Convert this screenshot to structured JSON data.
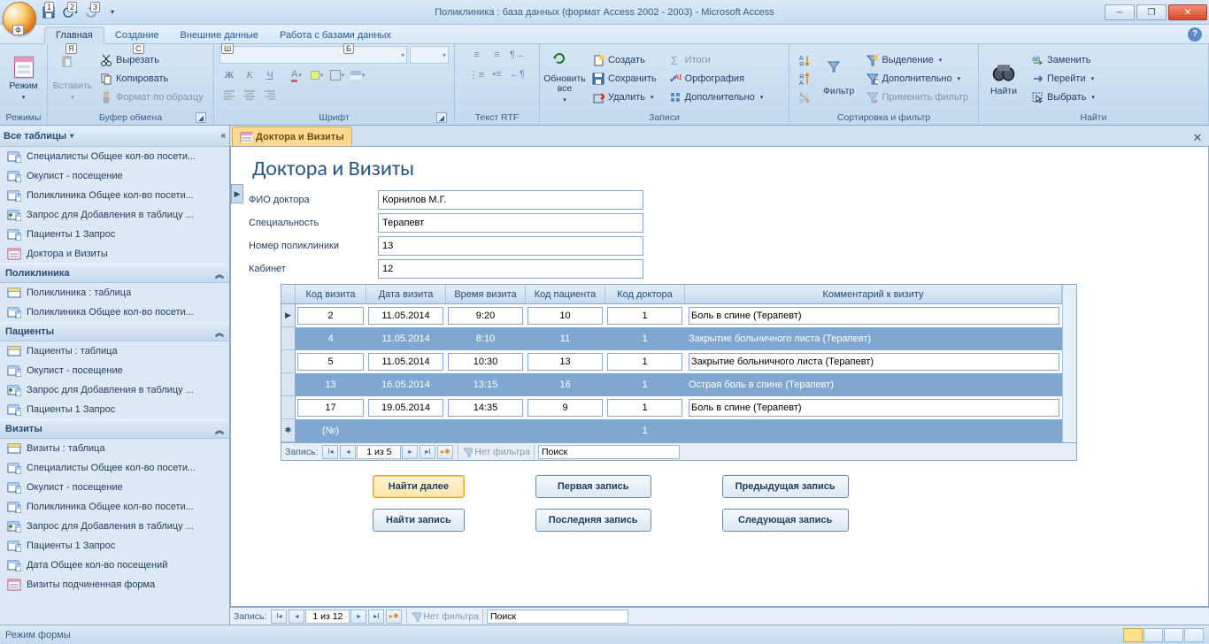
{
  "window": {
    "title": "Поликлиника : база данных (формат Access 2002 - 2003) - Microsoft Access",
    "kb_hints": [
      "1",
      "2",
      "3"
    ],
    "tabs": {
      "main": "Главная",
      "create": "Создание",
      "external": "Внешние данные",
      "dbtools": "Работа с базами данных"
    },
    "tab_kb": {
      "main": "Я",
      "create": "С",
      "external": "Ш",
      "dbtools": "Б"
    }
  },
  "ribbon": {
    "modes": {
      "big": "Режим",
      "group": "Режимы"
    },
    "clipboard": {
      "paste": "Вставить",
      "cut": "Вырезать",
      "copy": "Копировать",
      "format": "Формат по образцу",
      "group": "Буфер обмена"
    },
    "font": {
      "group": "Шрифт"
    },
    "richtext": {
      "group": "Текст RTF"
    },
    "records": {
      "refresh": "Обновить\nвсе",
      "new": "Создать",
      "save": "Сохранить",
      "delete": "Удалить",
      "totals": "Итоги",
      "spell": "Орфография",
      "more": "Дополнительно",
      "group": "Записи"
    },
    "sort": {
      "filter": "Фильтр",
      "selection": "Выделение",
      "advanced": "Дополнительно",
      "toggle": "Применить фильтр",
      "group": "Сортировка и фильтр"
    },
    "find": {
      "find": "Найти",
      "replace": "Заменить",
      "goto": "Перейти",
      "select": "Выбрать",
      "group": "Найти"
    }
  },
  "nav": {
    "head": "Все таблицы",
    "groups": [
      {
        "name": "",
        "items": [
          {
            "t": "q",
            "label": "Специалисты Общее кол-во посети..."
          },
          {
            "t": "q",
            "label": "Окулист - посещение"
          },
          {
            "t": "q",
            "label": "Поликлиника Общее кол-во посети..."
          },
          {
            "t": "aq",
            "label": "Запрос для Добавления в таблицу ..."
          },
          {
            "t": "q",
            "label": "Пациенты 1 Запрос"
          },
          {
            "t": "f",
            "label": "Доктора и Визиты"
          }
        ]
      },
      {
        "name": "Поликлиника",
        "items": [
          {
            "t": "t",
            "label": "Поликлиника : таблица"
          },
          {
            "t": "q",
            "label": "Поликлиника Общее кол-во посети..."
          }
        ]
      },
      {
        "name": "Пациенты",
        "items": [
          {
            "t": "t",
            "label": "Пациенты : таблица"
          },
          {
            "t": "q",
            "label": "Окулист - посещение"
          },
          {
            "t": "aq",
            "label": "Запрос для Добавления в таблицу ..."
          },
          {
            "t": "q",
            "label": "Пациенты 1 Запрос"
          }
        ]
      },
      {
        "name": "Визиты",
        "items": [
          {
            "t": "t",
            "label": "Визиты : таблица"
          },
          {
            "t": "q",
            "label": "Специалисты Общее кол-во посети..."
          },
          {
            "t": "q",
            "label": "Окулист - посещение"
          },
          {
            "t": "q",
            "label": "Поликлиника Общее кол-во посети..."
          },
          {
            "t": "aq",
            "label": "Запрос для Добавления в таблицу ..."
          },
          {
            "t": "q",
            "label": "Пациенты 1 Запрос"
          },
          {
            "t": "q",
            "label": "Дата Общее кол-во посещений"
          },
          {
            "t": "f",
            "label": "Визиты подчиненная форма"
          }
        ]
      }
    ]
  },
  "doc": {
    "tab": "Доктора и Визиты"
  },
  "form": {
    "title": "Доктора и Визиты",
    "fields": {
      "fio": {
        "label": "ФИО доктора",
        "value": "Корнилов М.Г."
      },
      "spec": {
        "label": "Специальность",
        "value": "Терапевт"
      },
      "clinic": {
        "label": "Номер поликлиники",
        "value": "13"
      },
      "room": {
        "label": "Кабинет",
        "value": "12"
      }
    },
    "sub": {
      "cols": [
        "Код визита",
        "Дата визита",
        "Время визита",
        "Код пациента",
        "Код доктора",
        "Комментарий к визиту"
      ],
      "rows": [
        {
          "boxed": true,
          "v": [
            "2",
            "11.05.2014",
            "9:20",
            "10",
            "1",
            "Боль в спине (Терапевт)"
          ]
        },
        {
          "boxed": false,
          "v": [
            "4",
            "11.05.2014",
            "8:10",
            "11",
            "1",
            "Закрытие больничного листа (Терапевт)"
          ]
        },
        {
          "boxed": true,
          "v": [
            "5",
            "11.05.2014",
            "10:30",
            "13",
            "1",
            "Закрытие больничного листа (Терапевт)"
          ]
        },
        {
          "boxed": false,
          "v": [
            "13",
            "16.05.2014",
            "13:15",
            "16",
            "1",
            "Острая боль в спине (Терапевт)"
          ]
        },
        {
          "boxed": true,
          "v": [
            "17",
            "19.05.2014",
            "14:35",
            "9",
            "1",
            "Боль в спине (Терапевт)"
          ]
        }
      ],
      "newrow": {
        "id": "(№)",
        "doc": "1"
      },
      "nav": {
        "label": "Запись:",
        "pos": "1 из 5",
        "filter": "Нет фильтра",
        "search": "Поиск"
      }
    },
    "buttons": {
      "findnext": "Найти далее",
      "findrec": "Найти запись",
      "first": "Первая запись",
      "last": "Последняя запись",
      "prev": "Предыдущая запись",
      "next": "Следующая запись"
    }
  },
  "outer_nav": {
    "label": "Запись:",
    "pos": "1 из 12",
    "filter": "Нет фильтра",
    "search": "Поиск"
  },
  "status": "Режим формы"
}
